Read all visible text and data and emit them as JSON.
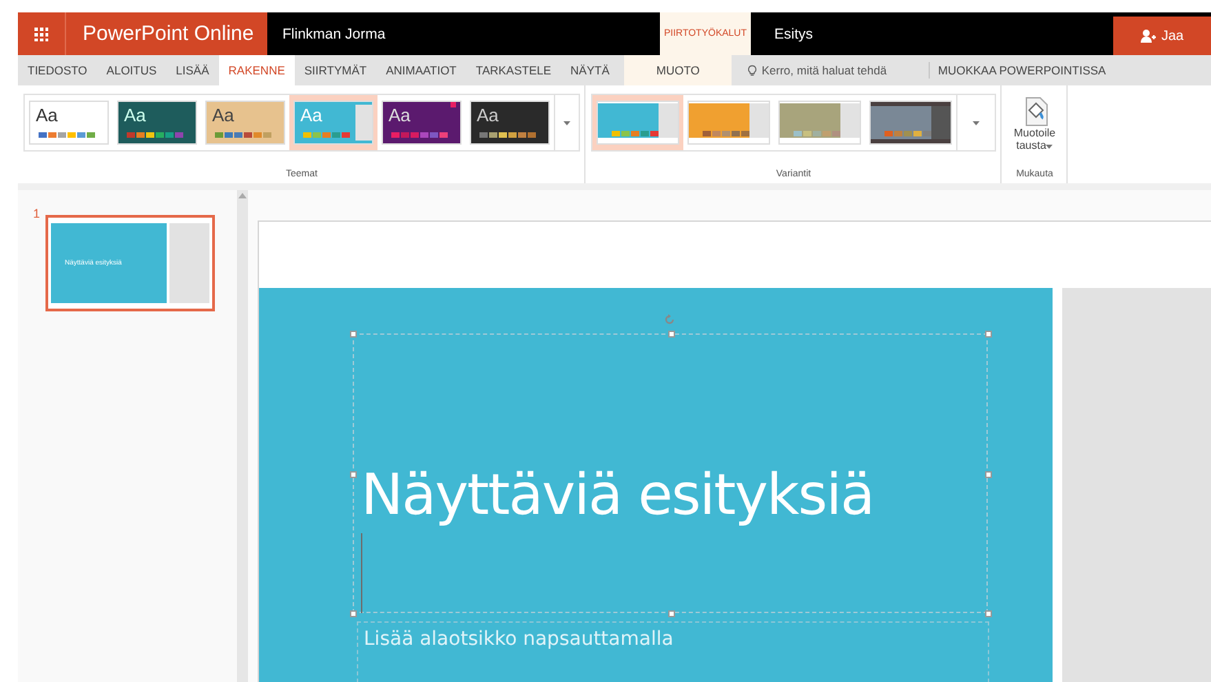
{
  "title_bar": {
    "app_name": "PowerPoint Online",
    "user": "Flinkman Jorma",
    "context_group": "PIIRTOTYÖKALUT",
    "document": "Esitys",
    "share_button": "Jaa"
  },
  "tabs": [
    {
      "label": "TIEDOSTO",
      "selected": false,
      "kind": "normal"
    },
    {
      "label": "ALOITUS",
      "selected": false,
      "kind": "normal"
    },
    {
      "label": "LISÄÄ",
      "selected": false,
      "kind": "normal"
    },
    {
      "label": "RAKENNE",
      "selected": true,
      "kind": "normal"
    },
    {
      "label": "SIIRTYMÄT",
      "selected": false,
      "kind": "normal"
    },
    {
      "label": "ANIMAATIOT",
      "selected": false,
      "kind": "normal"
    },
    {
      "label": "TARKASTELE",
      "selected": false,
      "kind": "normal"
    },
    {
      "label": "NÄYTÄ",
      "selected": false,
      "kind": "normal"
    },
    {
      "label": "MUOTO",
      "selected": false,
      "kind": "context"
    }
  ],
  "tell_me": {
    "placeholder": "Kerro, mitä haluat tehdä"
  },
  "edit_in_app": "MUOKKAA POWERPOINTISSA",
  "ribbon": {
    "themes": {
      "label": "Teemat",
      "items": [
        {
          "kind": "office",
          "text": "Aa",
          "selected": false
        },
        {
          "kind": "teal",
          "text": "Aa",
          "selected": false
        },
        {
          "kind": "wood",
          "text": "Aa",
          "selected": false
        },
        {
          "kind": "ion",
          "text": "Aa",
          "selected": true
        },
        {
          "kind": "purple",
          "text": "Aa",
          "selected": false
        },
        {
          "kind": "dark",
          "text": "Aa",
          "selected": false
        }
      ]
    },
    "variants": {
      "label": "Variantit",
      "items": [
        {
          "kind": "blue",
          "selected": true
        },
        {
          "kind": "orange",
          "selected": false
        },
        {
          "kind": "olive",
          "selected": false
        },
        {
          "kind": "slate",
          "selected": false
        }
      ]
    },
    "customize": {
      "label": "Mukauta",
      "button": "Muotoile tausta"
    }
  },
  "slides": [
    {
      "number": "1",
      "title": "Näyttäviä esityksiä",
      "selected": true
    }
  ],
  "slide": {
    "title": "Näyttäviä esityksiä",
    "subtitle_placeholder": "Lisää alaotsikko napsauttamalla"
  }
}
